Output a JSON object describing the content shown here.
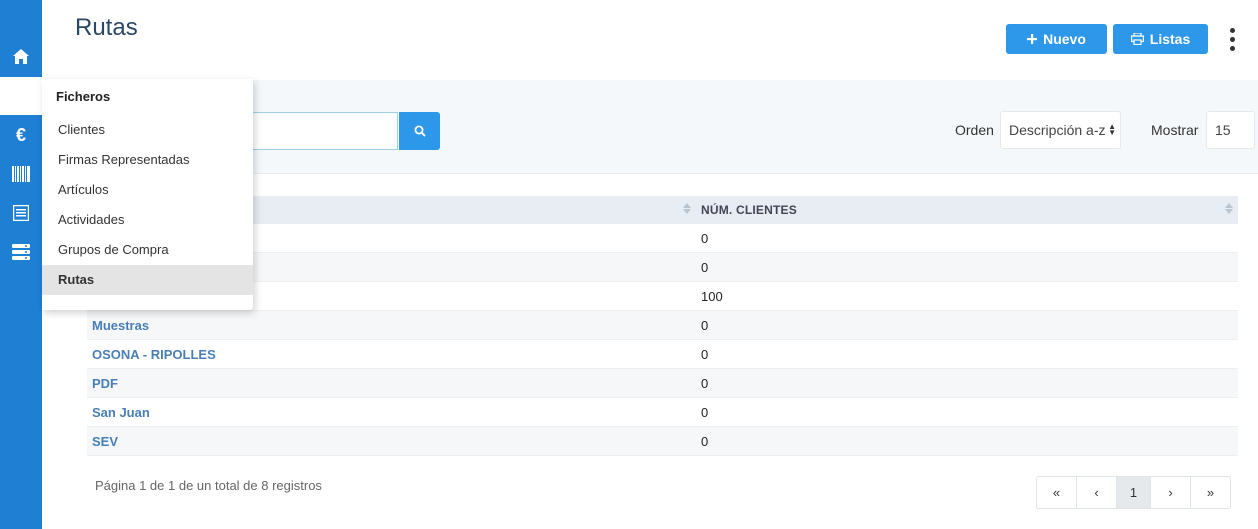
{
  "page": {
    "title": "Rutas"
  },
  "header": {
    "new_label": "Nuevo",
    "lists_label": "Listas"
  },
  "sidebar": {
    "icons": [
      "home-icon",
      "folder-icon",
      "euro-icon",
      "barcode-icon",
      "document-list-icon",
      "server-icon"
    ],
    "active": "folder-icon"
  },
  "menu": {
    "header": "Ficheros",
    "items": [
      {
        "label": "Clientes"
      },
      {
        "label": "Firmas Representadas"
      },
      {
        "label": "Artículos"
      },
      {
        "label": "Actividades"
      },
      {
        "label": "Grupos de Compra"
      },
      {
        "label": "Rutas"
      }
    ],
    "active": "Rutas"
  },
  "search": {
    "value": "",
    "button_icon": "search-icon"
  },
  "filters": {
    "order_label": "Orden",
    "order_value": "Descripción a-z",
    "show_label": "Mostrar",
    "show_value": "15"
  },
  "table": {
    "columns": [
      "NÚM. CLIENTES"
    ],
    "rows": [
      {
        "name": "",
        "clients": "0"
      },
      {
        "name": "",
        "clients": "0"
      },
      {
        "name": "",
        "clients": "100"
      },
      {
        "name": "Muestras",
        "clients": "0"
      },
      {
        "name": "OSONA - RIPOLLES",
        "clients": "0"
      },
      {
        "name": "PDF",
        "clients": "0"
      },
      {
        "name": "San Juan",
        "clients": "0"
      },
      {
        "name": "SEV",
        "clients": "0"
      }
    ]
  },
  "footer": {
    "summary": "Página 1 de 1 de un total de 8 registros",
    "pager": {
      "first": "«",
      "prev": "‹",
      "current": "1",
      "next": "›",
      "last": "»"
    }
  },
  "colors": {
    "rail": "#1f7fd3",
    "accent": "#2d97ea",
    "title": "#2b4766",
    "link": "#4a7fb5"
  }
}
